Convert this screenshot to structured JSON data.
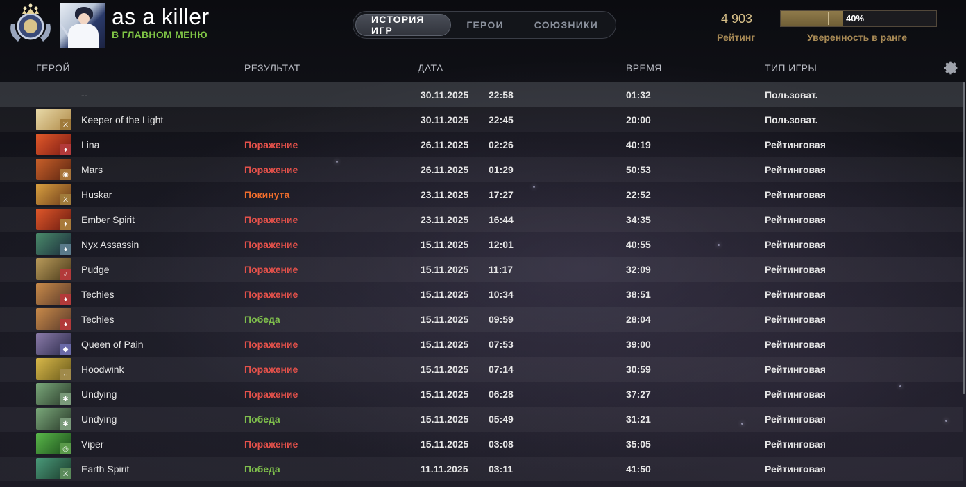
{
  "header": {
    "username": "as a killer",
    "status": "В ГЛАВНОМ МЕНЮ",
    "tabs": [
      {
        "label": "ИСТОРИЯ ИГР",
        "active": true
      },
      {
        "label": "ГЕРОИ",
        "active": false
      },
      {
        "label": "СОЮЗНИКИ",
        "active": false
      }
    ],
    "rating_value": "4 903",
    "rating_label": "Рейтинг",
    "confidence_percent": "40%",
    "confidence_fraction": 0.4,
    "confidence_label": "Уверенность в ранге"
  },
  "columns": {
    "hero": "ГЕРОЙ",
    "result": "РЕЗУЛЬТАТ",
    "date": "ДАТА",
    "duration": "ВРЕМЯ",
    "game_type": "ТИП ИГРЫ"
  },
  "colors": {
    "loss": "#e4514a",
    "win": "#7fbf4c",
    "abandon": "#f06d2c",
    "status_green": "#7fc445",
    "gold": "#a88a55"
  },
  "matches": [
    {
      "hero": "--",
      "result": "",
      "result_kind": "",
      "date": "30.11.2025",
      "time": "22:58",
      "duration": "01:32",
      "type": "Пользоват.",
      "portrait": [
        "transparent",
        "transparent"
      ],
      "role_icon": "",
      "role_color": ""
    },
    {
      "hero": "Keeper of the Light",
      "result": "",
      "result_kind": "",
      "date": "30.11.2025",
      "time": "22:45",
      "duration": "20:00",
      "type": "Пользоват.",
      "portrait": [
        "#e8d9a8",
        "#b08a48"
      ],
      "role_icon": "⚔",
      "role_color": "#a07a3a"
    },
    {
      "hero": "Lina",
      "result": "Поражение",
      "result_kind": "loss",
      "date": "26.11.2025",
      "time": "02:26",
      "duration": "40:19",
      "type": "Рейтинговая",
      "portrait": [
        "#e25a2a",
        "#7a1a14"
      ],
      "role_icon": "♦",
      "role_color": "#b23a3a"
    },
    {
      "hero": "Mars",
      "result": "Поражение",
      "result_kind": "loss",
      "date": "26.11.2025",
      "time": "01:29",
      "duration": "50:53",
      "type": "Рейтинговая",
      "portrait": [
        "#c9602a",
        "#5a2410"
      ],
      "role_icon": "◉",
      "role_color": "#a8743a"
    },
    {
      "hero": "Huskar",
      "result": "Покинута",
      "result_kind": "abandon",
      "date": "23.11.2025",
      "time": "17:27",
      "duration": "22:52",
      "type": "Рейтинговая",
      "portrait": [
        "#d9a040",
        "#6a3a1a"
      ],
      "role_icon": "⚔",
      "role_color": "#a07a3a"
    },
    {
      "hero": "Ember Spirit",
      "result": "Поражение",
      "result_kind": "loss",
      "date": "23.11.2025",
      "time": "16:44",
      "duration": "34:35",
      "type": "Рейтинговая",
      "portrait": [
        "#e0582a",
        "#6a1a10"
      ],
      "role_icon": "✦",
      "role_color": "#a87a3a"
    },
    {
      "hero": "Nyx Assassin",
      "result": "Поражение",
      "result_kind": "loss",
      "date": "15.11.2025",
      "time": "12:01",
      "duration": "40:55",
      "type": "Рейтинговая",
      "portrait": [
        "#4a8a6a",
        "#1a2a3a"
      ],
      "role_icon": "♦",
      "role_color": "#5a7a8a"
    },
    {
      "hero": "Pudge",
      "result": "Поражение",
      "result_kind": "loss",
      "date": "15.11.2025",
      "time": "11:17",
      "duration": "32:09",
      "type": "Рейтинговая",
      "portrait": [
        "#b89a5a",
        "#4a3a1a"
      ],
      "role_icon": "♂",
      "role_color": "#b23a3a"
    },
    {
      "hero": "Techies",
      "result": "Поражение",
      "result_kind": "loss",
      "date": "15.11.2025",
      "time": "10:34",
      "duration": "38:51",
      "type": "Рейтинговая",
      "portrait": [
        "#c88a4a",
        "#5a3a2a"
      ],
      "role_icon": "♦",
      "role_color": "#b23a3a"
    },
    {
      "hero": "Techies",
      "result": "Победа",
      "result_kind": "win",
      "date": "15.11.2025",
      "time": "09:59",
      "duration": "28:04",
      "type": "Рейтинговая",
      "portrait": [
        "#c88a4a",
        "#5a3a2a"
      ],
      "role_icon": "♦",
      "role_color": "#b23a3a"
    },
    {
      "hero": "Queen of Pain",
      "result": "Поражение",
      "result_kind": "loss",
      "date": "15.11.2025",
      "time": "07:53",
      "duration": "39:00",
      "type": "Рейтинговая",
      "portrait": [
        "#8a7aa8",
        "#2a2a4a"
      ],
      "role_icon": "◆",
      "role_color": "#6a6aa8"
    },
    {
      "hero": "Hoodwink",
      "result": "Поражение",
      "result_kind": "loss",
      "date": "15.11.2025",
      "time": "07:14",
      "duration": "30:59",
      "type": "Рейтинговая",
      "portrait": [
        "#d8b84a",
        "#6a5a1a"
      ],
      "role_icon": "↔",
      "role_color": "#a08a4a"
    },
    {
      "hero": "Undying",
      "result": "Поражение",
      "result_kind": "loss",
      "date": "15.11.2025",
      "time": "06:28",
      "duration": "37:27",
      "type": "Рейтинговая",
      "portrait": [
        "#7aa87a",
        "#2a3a2a"
      ],
      "role_icon": "✱",
      "role_color": "#7a9a7a"
    },
    {
      "hero": "Undying",
      "result": "Победа",
      "result_kind": "win",
      "date": "15.11.2025",
      "time": "05:49",
      "duration": "31:21",
      "type": "Рейтинговая",
      "portrait": [
        "#7aa87a",
        "#2a3a2a"
      ],
      "role_icon": "✱",
      "role_color": "#7a9a7a"
    },
    {
      "hero": "Viper",
      "result": "Поражение",
      "result_kind": "loss",
      "date": "15.11.2025",
      "time": "03:08",
      "duration": "35:05",
      "type": "Рейтинговая",
      "portrait": [
        "#5ab84a",
        "#1a4a1a"
      ],
      "role_icon": "◎",
      "role_color": "#5a9a4a"
    },
    {
      "hero": "Earth Spirit",
      "result": "Победа",
      "result_kind": "win",
      "date": "11.11.2025",
      "time": "03:11",
      "duration": "41:50",
      "type": "Рейтинговая",
      "portrait": [
        "#4a9a7a",
        "#1a3a2a"
      ],
      "role_icon": "⚔",
      "role_color": "#5a8a5a"
    }
  ]
}
